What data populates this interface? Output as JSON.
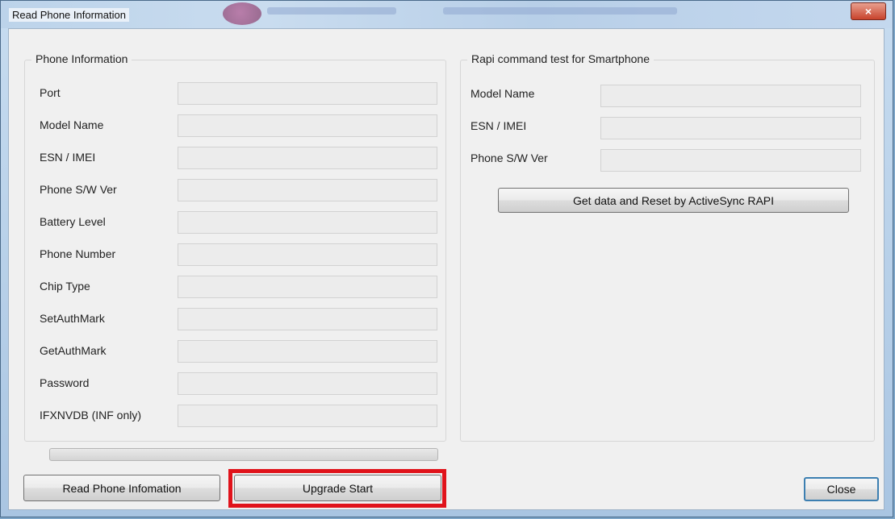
{
  "window": {
    "title": "Read Phone Information",
    "close_glyph": "×"
  },
  "phone_info": {
    "legend": "Phone Information",
    "rows": [
      {
        "label": "Port",
        "value": ""
      },
      {
        "label": "Model Name",
        "value": ""
      },
      {
        "label": "ESN / IMEI",
        "value": ""
      },
      {
        "label": "Phone S/W Ver",
        "value": ""
      },
      {
        "label": "Battery Level",
        "value": ""
      },
      {
        "label": "Phone Number",
        "value": ""
      },
      {
        "label": "Chip Type",
        "value": ""
      },
      {
        "label": "SetAuthMark",
        "value": ""
      },
      {
        "label": "GetAuthMark",
        "value": ""
      },
      {
        "label": "Password",
        "value": ""
      },
      {
        "label": "IFXNVDB (INF only)",
        "value": ""
      }
    ]
  },
  "rapi": {
    "legend": "Rapi command test for Smartphone",
    "rows": [
      {
        "label": "Model Name",
        "value": ""
      },
      {
        "label": "ESN / IMEI",
        "value": ""
      },
      {
        "label": "Phone S/W Ver",
        "value": ""
      }
    ],
    "get_data_button": "Get data and Reset by ActiveSync RAPI"
  },
  "progress": {
    "fraction": 0
  },
  "buttons": {
    "read_phone": "Read Phone Infomation",
    "upgrade_start": "Upgrade Start",
    "close": "Close"
  },
  "colors": {
    "highlight": "#e0131b",
    "titlebar": "#c0d6ec",
    "client_bg": "#f0f0f0"
  }
}
